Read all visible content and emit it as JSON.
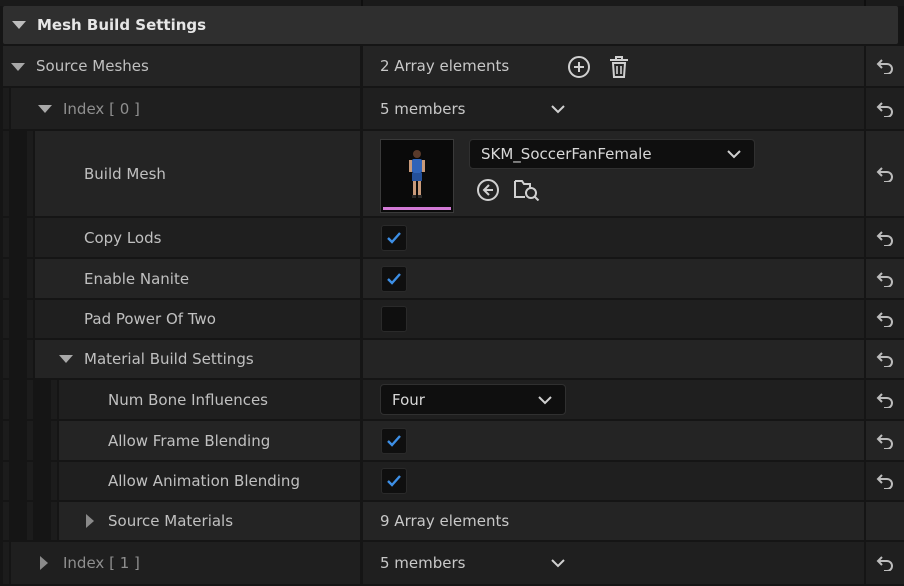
{
  "section": {
    "title": "Mesh Build Settings"
  },
  "source_meshes": {
    "label": "Source Meshes",
    "value": "2 Array elements",
    "add_icon": "plus-circle-icon",
    "delete_icon": "trash-icon"
  },
  "index0": {
    "label": "Index",
    "index": "[ 0 ]",
    "value": "5 members"
  },
  "build_mesh": {
    "label": "Build Mesh",
    "asset": "SKM_SoccerFanFemale",
    "browse_icon": "arrow-left-circle-icon",
    "find_icon": "folder-search-icon"
  },
  "copy_lods": {
    "label": "Copy Lods",
    "checked": true
  },
  "enable_nanite": {
    "label": "Enable Nanite",
    "checked": true
  },
  "pad_power": {
    "label": "Pad Power Of Two",
    "checked": false
  },
  "material_build": {
    "label": "Material Build Settings"
  },
  "num_bone": {
    "label": "Num Bone Influences",
    "value": "Four"
  },
  "allow_frame": {
    "label": "Allow Frame Blending",
    "checked": true
  },
  "allow_anim": {
    "label": "Allow Animation Blending",
    "checked": true
  },
  "source_materials": {
    "label": "Source Materials",
    "value": "9 Array elements"
  },
  "index1": {
    "label": "Index",
    "index": "[ 1 ]",
    "value": "5 members"
  },
  "colors": {
    "accent": "#3d8fe6",
    "thumb_underline": "#d27ad6"
  },
  "reset_icon": "reset-arrow-icon"
}
